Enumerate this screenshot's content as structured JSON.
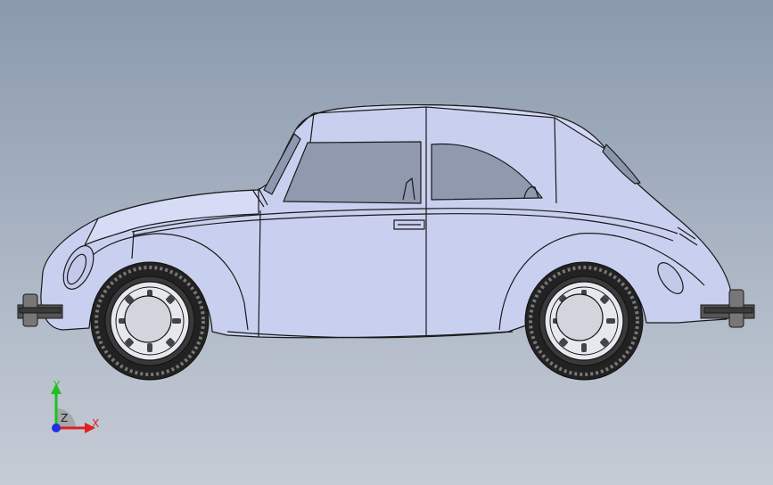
{
  "viewport": {
    "background_top": "#8a9aad",
    "background_bottom": "#c6ccd6",
    "model_fill": "#c9d0ef",
    "edge_color": "#1a1a1a"
  },
  "triad": {
    "x_label": "X",
    "y_label": "Y",
    "z_label": "Z",
    "x_color": "#e02020",
    "y_color": "#20c020",
    "z_color": "#2030e0"
  }
}
